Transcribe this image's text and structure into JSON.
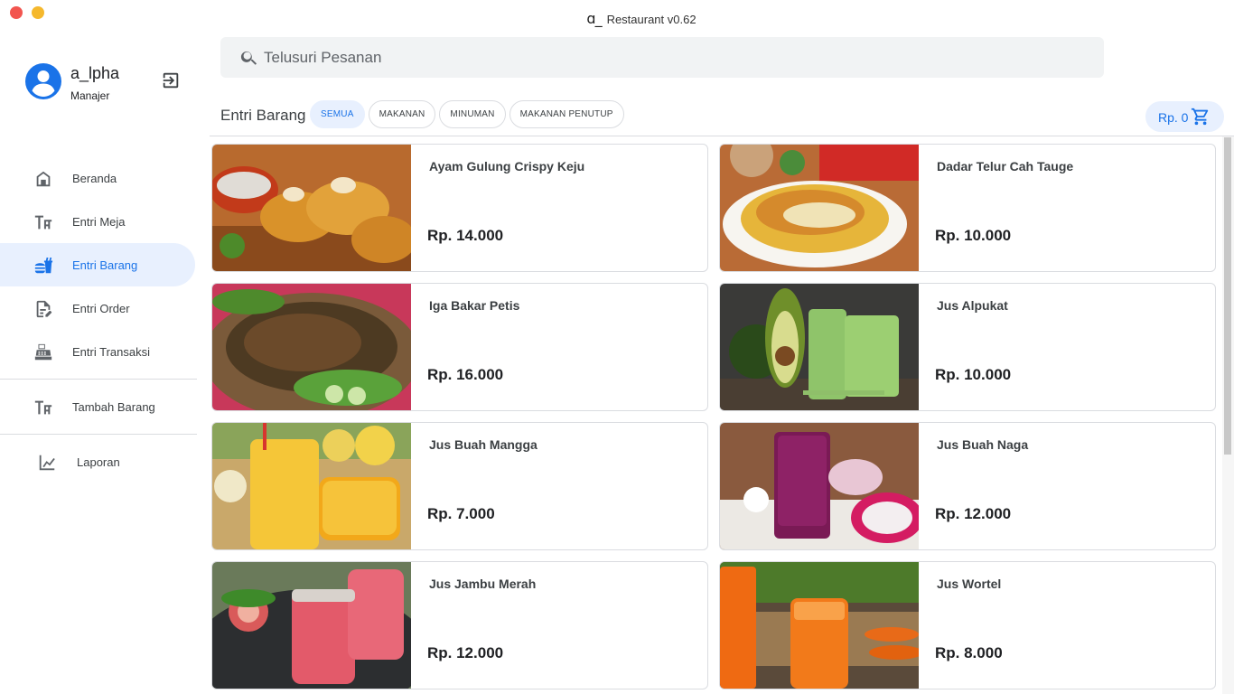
{
  "window": {
    "logo": "ɑ_",
    "title": "Restaurant v0.62"
  },
  "user": {
    "name": "a_lpha",
    "role": "Manajer"
  },
  "nav": [
    {
      "label": "Beranda",
      "icon": "home-icon"
    },
    {
      "label": "Entri Meja",
      "icon": "table-icon"
    },
    {
      "label": "Entri Barang",
      "icon": "food-icon",
      "active": true
    },
    {
      "label": "Entri Order",
      "icon": "order-icon"
    },
    {
      "label": "Entri Transaksi",
      "icon": "cash-register-icon"
    },
    {
      "label": "Tambah Barang",
      "icon": "table-add-icon"
    },
    {
      "label": "Laporan",
      "icon": "chart-line-icon"
    }
  ],
  "search": {
    "placeholder": "Telusuri Pesanan"
  },
  "section": {
    "title": "Entri Barang"
  },
  "filters": [
    "SEMUA",
    "MAKANAN",
    "MINUMAN",
    "MAKANAN PENUTUP"
  ],
  "cart": {
    "total": "Rp. 0"
  },
  "colors": {
    "accent": "#1a73e8",
    "accent_light": "#e8f0fe",
    "close": "#f2554f",
    "minimize": "#f5b82d"
  },
  "items": [
    {
      "name": "Ayam Gulung Crispy Keju",
      "price": "Rp. 14.000"
    },
    {
      "name": "Dadar Telur Cah Tauge",
      "price": "Rp. 10.000"
    },
    {
      "name": "Iga Bakar Petis",
      "price": "Rp. 16.000"
    },
    {
      "name": "Jus Alpukat",
      "price": "Rp. 10.000"
    },
    {
      "name": "Jus Buah Mangga",
      "price": "Rp. 7.000"
    },
    {
      "name": "Jus Buah Naga",
      "price": "Rp. 12.000"
    },
    {
      "name": "Jus Jambu Merah",
      "price": "Rp. 12.000"
    },
    {
      "name": "Jus Wortel",
      "price": "Rp. 8.000"
    }
  ]
}
